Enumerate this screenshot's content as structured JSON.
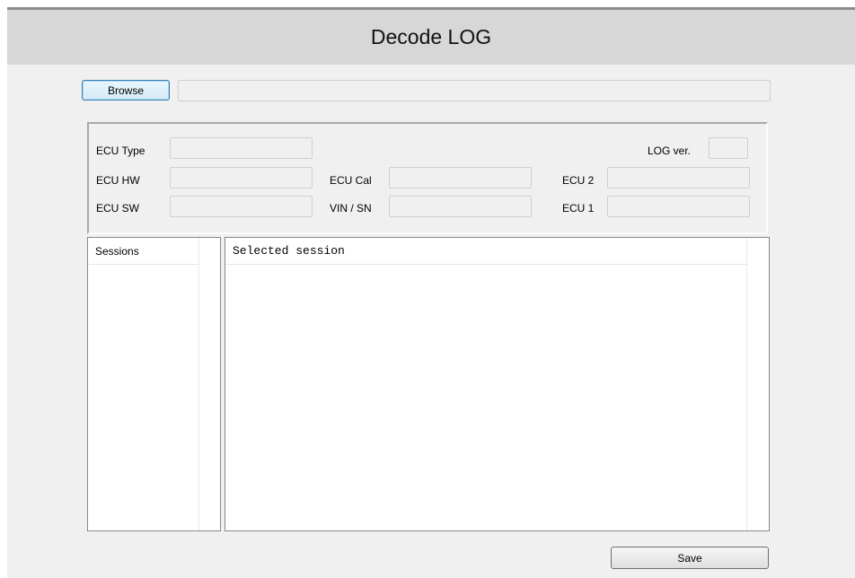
{
  "window": {
    "title": "Decode LOG"
  },
  "file": {
    "browse_label": "Browse",
    "path_value": ""
  },
  "ecu_info": {
    "ecu_type_label": "ECU Type",
    "ecu_hw_label": "ECU HW",
    "ecu_sw_label": "ECU SW",
    "ecu_cal_label": "ECU Cal",
    "vin_sn_label": "VIN / SN",
    "log_ver_label": "LOG ver.",
    "ecu2_label": "ECU 2",
    "ecu1_label": "ECU 1",
    "ecu_type_value": "",
    "ecu_hw_value": "",
    "ecu_sw_value": "",
    "ecu_cal_value": "",
    "vin_sn_value": "",
    "log_ver_value": "",
    "ecu2_value": "",
    "ecu1_value": ""
  },
  "sessions_list": {
    "header": "Sessions",
    "items": []
  },
  "session_view": {
    "header": "Selected session",
    "items": []
  },
  "footer": {
    "save_label": "Save"
  }
}
